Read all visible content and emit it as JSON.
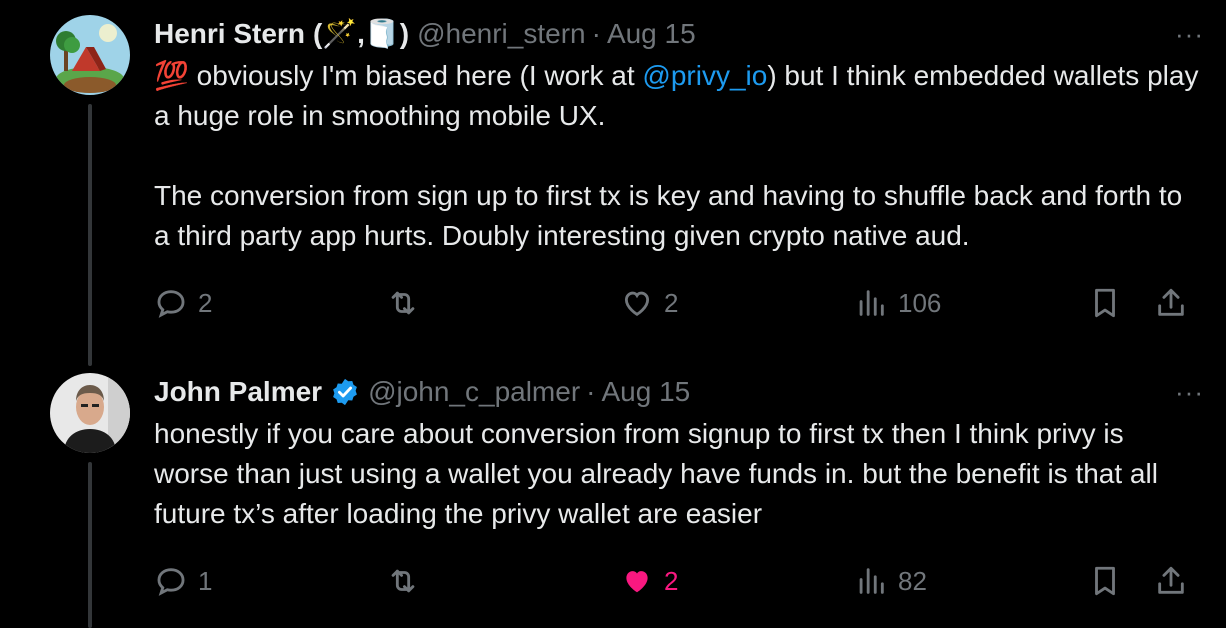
{
  "tweets": [
    {
      "author_name": "Henri Stern",
      "author_emoji": "(🪄,🧻)",
      "handle": "@henri_stern",
      "separator": "·",
      "date": "Aug 15",
      "more": "···",
      "body_line1_prefix": "💯 obviously I'm biased here (I work at ",
      "body_mention": "@privy_io",
      "body_line1_suffix": ") but I think embedded wallets play a huge role in smoothing mobile UX.",
      "body_paragraph2": "The conversion from sign up to first tx is key and having to shuffle back and forth to a third party app hurts. Doubly interesting given crypto native aud.",
      "replies": "2",
      "retweets": "",
      "likes": "2",
      "views": "106",
      "liked": false
    },
    {
      "author_name": "John Palmer",
      "verified": true,
      "handle": "@john_c_palmer",
      "separator": "·",
      "date": "Aug 15",
      "more": "···",
      "body": "honestly if you care about conversion from signup to first tx then I think privy is worse than just using a wallet you already have funds in. but the benefit is that all future tx’s after loading the privy wallet are easier",
      "replies": "1",
      "retweets": "",
      "likes": "2",
      "views": "82",
      "liked": true
    }
  ],
  "colors": {
    "background": "#000000",
    "text": "#e7e9ea",
    "muted": "#71767b",
    "link": "#1d9bf0",
    "like": "#f91880",
    "verified": "#1d9bf0"
  },
  "icons": [
    "reply-icon",
    "retweet-icon",
    "like-icon",
    "views-icon",
    "bookmark-icon",
    "share-icon",
    "verified-badge-icon",
    "more-icon"
  ]
}
